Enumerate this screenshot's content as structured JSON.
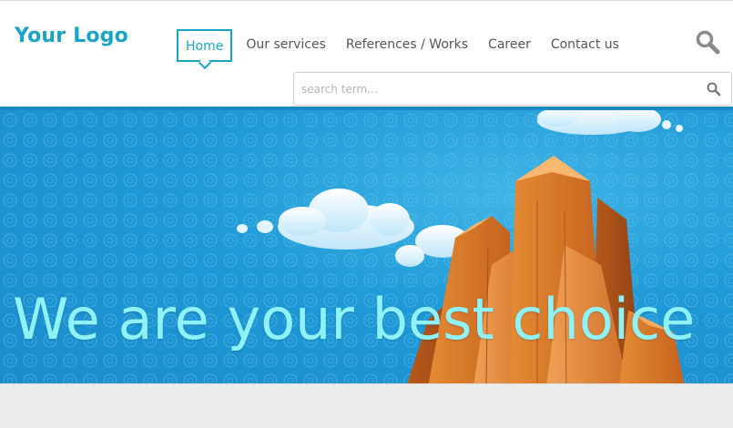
{
  "logo": {
    "text": "Your Logo"
  },
  "nav": {
    "items": [
      {
        "label": "Home",
        "active": true
      },
      {
        "label": "Our services",
        "active": false
      },
      {
        "label": "References / Works",
        "active": false
      },
      {
        "label": "Career",
        "active": false
      },
      {
        "label": "Contact us",
        "active": false
      }
    ]
  },
  "search": {
    "placeholder": "search term...",
    "toggle_icon": "search-icon",
    "submit_icon": "search-icon"
  },
  "hero": {
    "headline": "We are your best choice"
  },
  "colors": {
    "accent": "#1ba3c6",
    "headline": "#8ff2f6",
    "hero_blue": "#1f9ad7",
    "building_orange": "#d9782a"
  }
}
